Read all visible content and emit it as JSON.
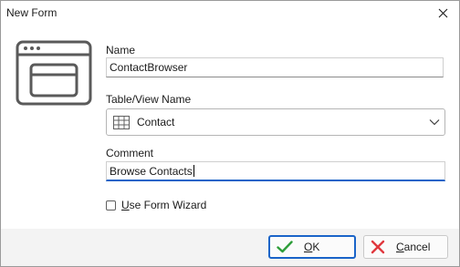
{
  "window": {
    "title": "New Form",
    "close_icon": "close-icon"
  },
  "form": {
    "name_label": "Name",
    "name_value": "ContactBrowser",
    "table_label": "Table/View Name",
    "table_value": "Contact",
    "table_icon": "table-grid-icon",
    "comment_label": "Comment",
    "comment_value": "Browse Contacts",
    "wizard_label_underlined": "U",
    "wizard_label_rest": "se Form Wizard",
    "wizard_checked": false
  },
  "buttons": {
    "ok_underlined": "O",
    "ok_rest": "K",
    "cancel_underlined": "C",
    "cancel_rest": "ancel"
  },
  "colors": {
    "accent": "#1a64c8",
    "ok_check": "#2e9e3a",
    "cancel_x": "#e0383e"
  }
}
